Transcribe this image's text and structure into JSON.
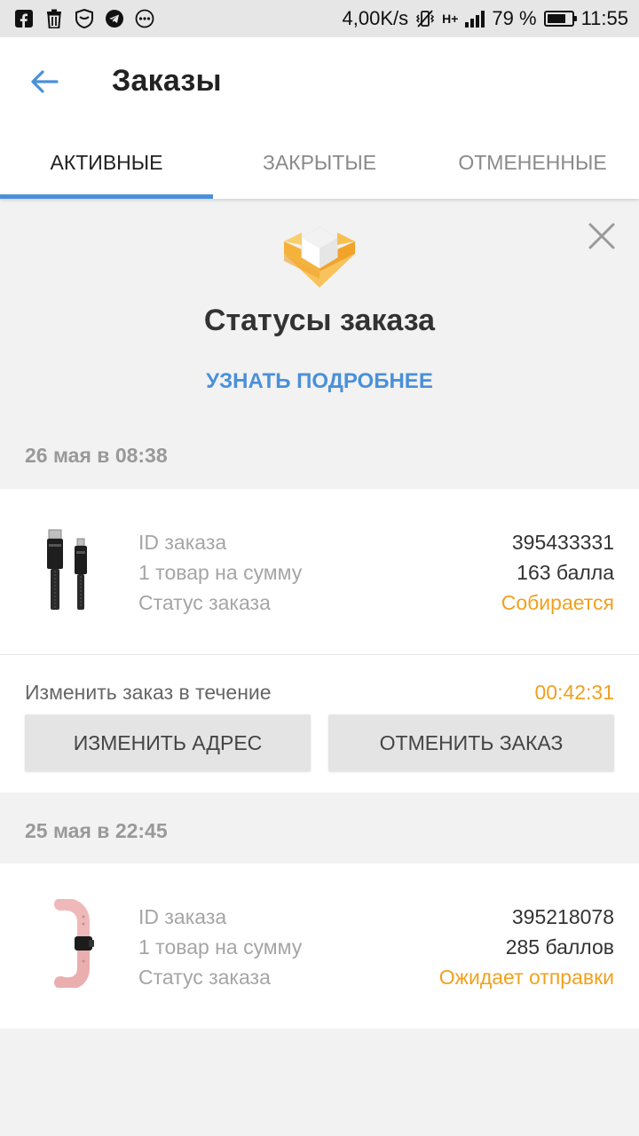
{
  "status_bar": {
    "net_speed": "4,00K/s",
    "network_type": "H+",
    "battery_percent": "79 %",
    "battery_level": 0.79,
    "time": "11:55"
  },
  "header": {
    "title": "Заказы"
  },
  "tabs": [
    {
      "label": "АКТИВНЫЕ",
      "active": true
    },
    {
      "label": "ЗАКРЫТЫЕ",
      "active": false
    },
    {
      "label": "ОТМЕНЕННЫЕ",
      "active": false
    }
  ],
  "banner": {
    "title": "Статусы заказа",
    "link_label": "УЗНАТЬ ПОДРОБНЕЕ"
  },
  "orders": [
    {
      "date": "26 мая в 08:38",
      "id_label": "ID заказа",
      "id_value": "395433331",
      "sum_label": "1 товар на сумму",
      "sum_value": "163 балла",
      "status_label": "Статус заказа",
      "status_value": "Собирается",
      "change_label": "Изменить заказ в течение",
      "change_timer": "00:42:31",
      "change_address_label": "ИЗМЕНИТЬ АДРЕС",
      "cancel_label": "ОТМЕНИТЬ ЗАКАЗ"
    },
    {
      "date": "25 мая в 22:45",
      "id_label": "ID заказа",
      "id_value": "395218078",
      "sum_label": "1 товар на сумму",
      "sum_value": "285 баллов",
      "status_label": "Статус заказа",
      "status_value": "Ожидает отправки"
    }
  ],
  "colors": {
    "accent": "#4a90d9",
    "status": "#f0a11f"
  }
}
